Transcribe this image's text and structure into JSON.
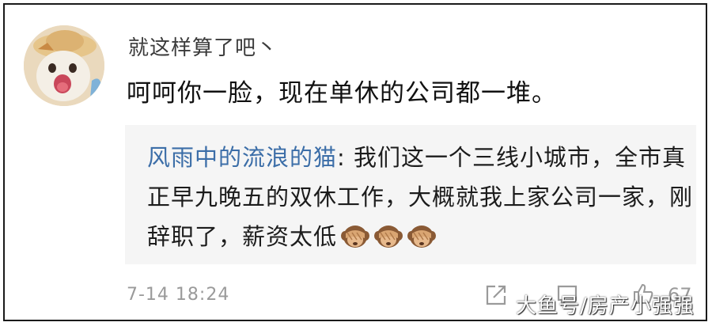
{
  "comment": {
    "username": "就这样算了吧丶",
    "text": "呵呵你一脸，现在单休的公司都一堆。",
    "timestamp": "7-14 18:24"
  },
  "quoted_reply": {
    "author": "风雨中的流浪的猫",
    "separator": ": ",
    "text": "我们这一个三线小城市，全市真正早九晚五的双休工作，大概就我上家公司一家，刚辞职了，薪资太低",
    "emoji_icons": [
      "see-no-evil-monkey-icon",
      "see-no-evil-monkey-icon",
      "see-no-evil-monkey-icon"
    ]
  },
  "actions": {
    "icons": [
      "share-icon",
      "comment-icon",
      "like-icon"
    ],
    "like_count": "67"
  },
  "watermark": {
    "text": "大鱼号/房产小强强"
  },
  "colors": {
    "author_link": "#3c6ea8",
    "quote_background": "#f5f5f5",
    "meta_text": "#9a9a9a"
  }
}
